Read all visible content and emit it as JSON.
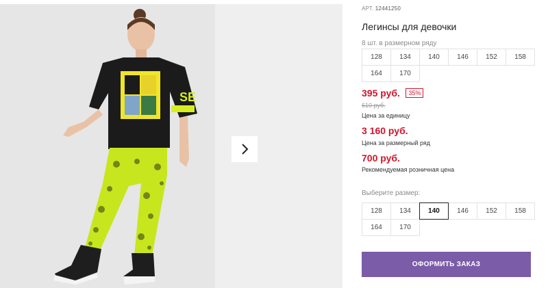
{
  "product": {
    "article_label": "АРТ.",
    "article_number": "12441250",
    "title": "Легинсы для девочки"
  },
  "gallery": {
    "next_icon": "chevron-right-icon"
  },
  "row_sizes": {
    "label": "8 шт. в размерном ряду",
    "sizes": [
      "128",
      "134",
      "140",
      "146",
      "152",
      "158",
      "164",
      "170"
    ]
  },
  "prices": {
    "unit_price": "395 руб.",
    "discount": "35%",
    "old_price": "610 руб.",
    "unit_label": "Цена за единицу",
    "row_price": "3 160 руб.",
    "row_label": "Цена за размерный ряд",
    "retail_price": "700 руб.",
    "retail_label": "Рекомендуемая розничная цена"
  },
  "size_select": {
    "label": "Выберите размер:",
    "sizes": [
      "128",
      "134",
      "140",
      "146",
      "152",
      "158",
      "164",
      "170"
    ],
    "selected": "140"
  },
  "actions": {
    "order_label": "ОФОРМИТЬ ЗАКАЗ",
    "order_color": "#7b5ca8"
  },
  "colors": {
    "price_red": "#d0152b",
    "leggings_lime": "#c8e61e"
  }
}
